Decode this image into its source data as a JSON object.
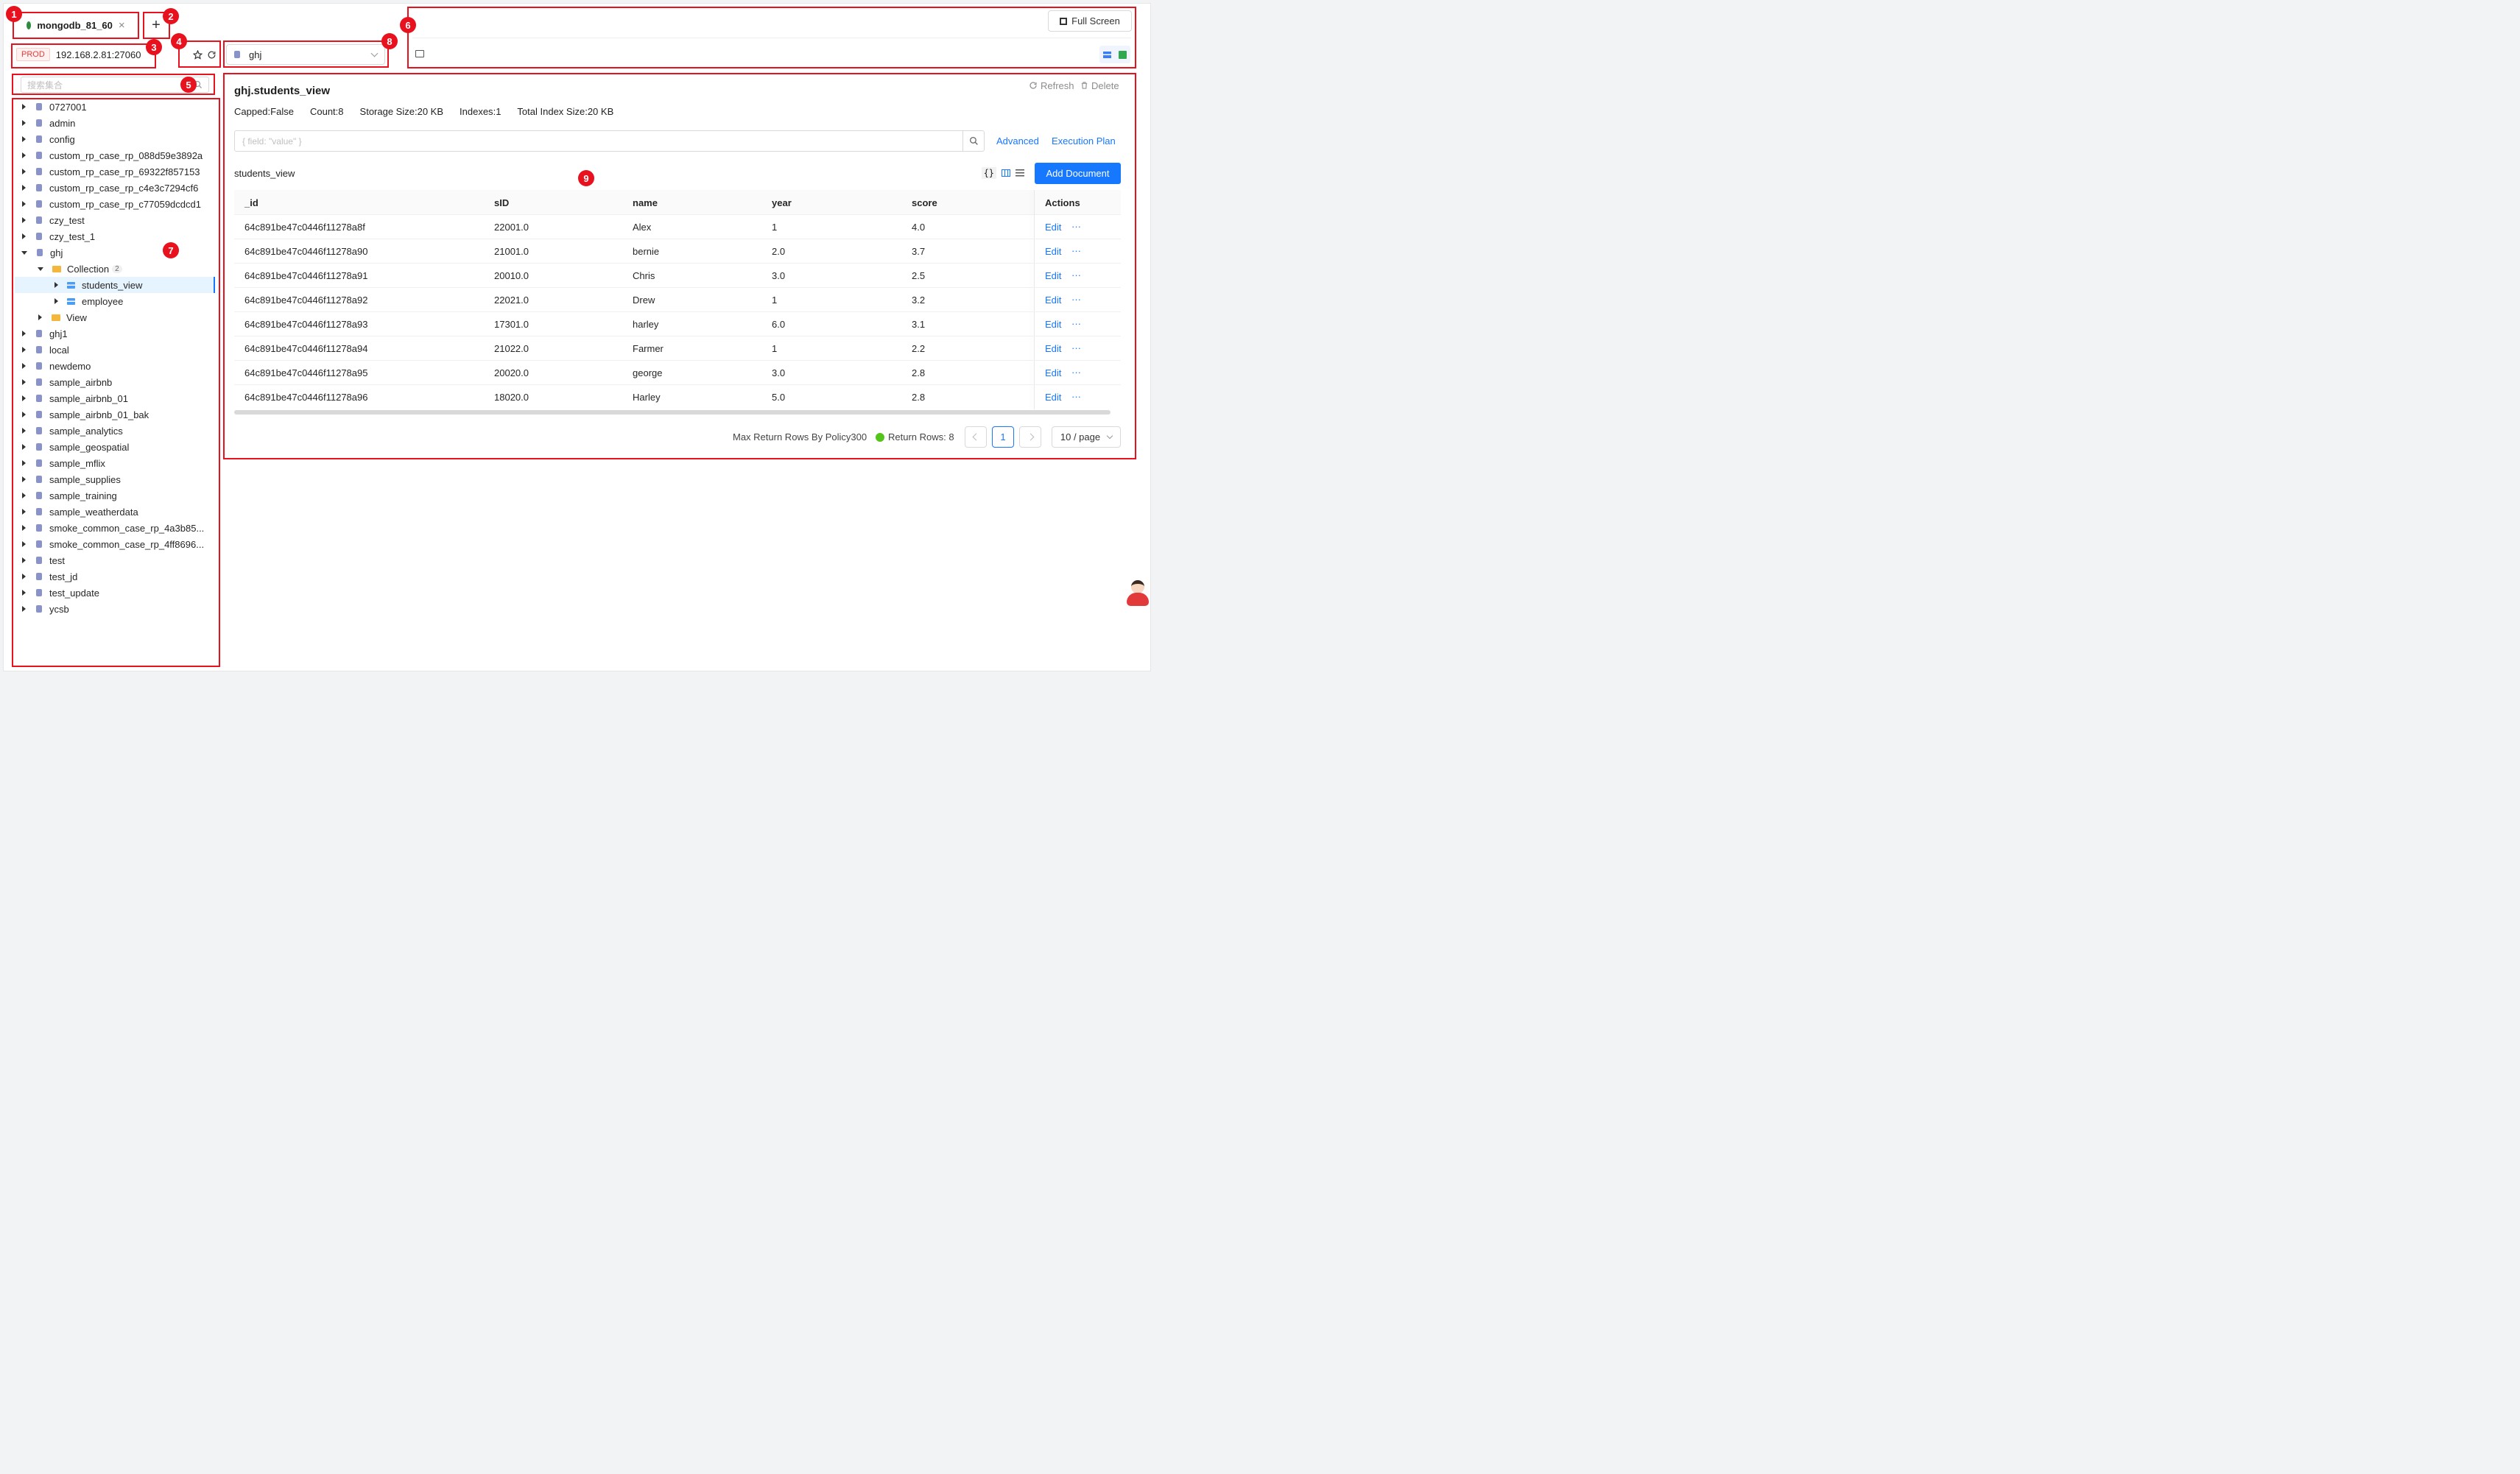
{
  "tab": {
    "title": "mongodb_81_60",
    "close": "×",
    "add": "+"
  },
  "connection": {
    "env_tag": "PROD",
    "host": "192.168.2.81:27060"
  },
  "db_select": {
    "value": "ghj"
  },
  "toolbar": {
    "full_screen": "Full Screen"
  },
  "sidebar": {
    "search_placeholder": "搜索集合",
    "items": [
      {
        "label": "0727001"
      },
      {
        "label": "admin"
      },
      {
        "label": "config"
      },
      {
        "label": "custom_rp_case_rp_088d59e3892a"
      },
      {
        "label": "custom_rp_case_rp_69322f857153"
      },
      {
        "label": "custom_rp_case_rp_c4e3c7294cf6"
      },
      {
        "label": "custom_rp_case_rp_c77059dcdcd1"
      },
      {
        "label": "czy_test"
      },
      {
        "label": "czy_test_1"
      },
      {
        "label": "ghj"
      },
      {
        "label": "ghj1"
      },
      {
        "label": "local"
      },
      {
        "label": "newdemo"
      },
      {
        "label": "sample_airbnb"
      },
      {
        "label": "sample_airbnb_01"
      },
      {
        "label": "sample_airbnb_01_bak"
      },
      {
        "label": "sample_analytics"
      },
      {
        "label": "sample_geospatial"
      },
      {
        "label": "sample_mflix"
      },
      {
        "label": "sample_supplies"
      },
      {
        "label": "sample_training"
      },
      {
        "label": "sample_weatherdata"
      },
      {
        "label": "smoke_common_case_rp_4a3b85..."
      },
      {
        "label": "smoke_common_case_rp_4ff8696..."
      },
      {
        "label": "test"
      },
      {
        "label": "test_jd"
      },
      {
        "label": "test_update"
      },
      {
        "label": "ycsb"
      }
    ],
    "ghj_children": {
      "collection_label": "Collection",
      "collection_count": "2",
      "collections": [
        "students_view",
        "employee"
      ],
      "view_label": "View"
    }
  },
  "main": {
    "title": "ghj.students_view",
    "refresh": "Refresh",
    "delete": "Delete",
    "stats": [
      {
        "label": "Capped",
        "value": "False"
      },
      {
        "label": "Count",
        "value": "8"
      },
      {
        "label": "Storage Size",
        "value": "20 KB"
      },
      {
        "label": "Indexes",
        "value": "1"
      },
      {
        "label": "Total Index Size",
        "value": "20 KB"
      }
    ],
    "query_placeholder": "{ field: \"value\" }",
    "advanced": "Advanced",
    "execution_plan": "Execution Plan",
    "collection_name": "students_view",
    "add_document": "Add Document",
    "columns": [
      "_id",
      "sID",
      "name",
      "year",
      "score",
      "Actions"
    ],
    "rows": [
      [
        "64c891be47c0446f11278a8f",
        "22001.0",
        "Alex",
        "1",
        "4.0"
      ],
      [
        "64c891be47c0446f11278a90",
        "21001.0",
        "bernie",
        "2.0",
        "3.7"
      ],
      [
        "64c891be47c0446f11278a91",
        "20010.0",
        "Chris",
        "3.0",
        "2.5"
      ],
      [
        "64c891be47c0446f11278a92",
        "22021.0",
        "Drew",
        "1",
        "3.2"
      ],
      [
        "64c891be47c0446f11278a93",
        "17301.0",
        "harley",
        "6.0",
        "3.1"
      ],
      [
        "64c891be47c0446f11278a94",
        "21022.0",
        "Farmer",
        "1",
        "2.2"
      ],
      [
        "64c891be47c0446f11278a95",
        "20020.0",
        "george",
        "3.0",
        "2.8"
      ],
      [
        "64c891be47c0446f11278a96",
        "18020.0",
        "Harley",
        "5.0",
        "2.8"
      ]
    ],
    "row_edit": "Edit",
    "row_more": "···",
    "footer": {
      "max_rows": "Max Return Rows By Policy300",
      "return_rows": "Return Rows: 8",
      "page": "1",
      "page_size": "10 / page"
    }
  },
  "annotations": [
    "1",
    "2",
    "3",
    "4",
    "5",
    "6",
    "7",
    "8",
    "9"
  ],
  "colors": {
    "accent": "#1677ff",
    "annotation": "#e8121e",
    "prod": "#e8393d"
  }
}
